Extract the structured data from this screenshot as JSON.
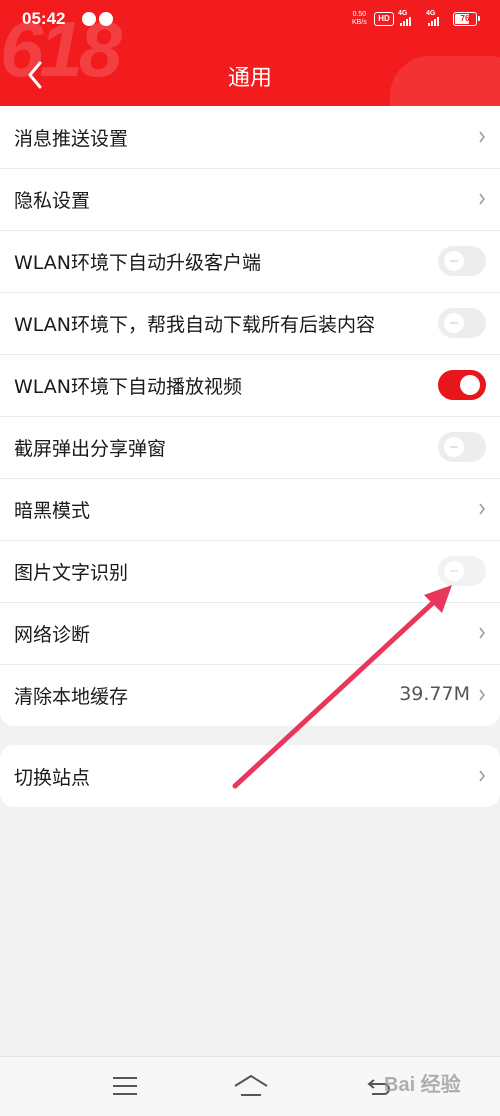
{
  "status_bar": {
    "time": "05:42",
    "net_speed_value": "0.50",
    "net_speed_unit": "KB/s",
    "hd_badge": "HD",
    "sim1_label": "4G",
    "sim2_label": "4G",
    "battery_percent": "76",
    "battery_level": 0.76
  },
  "header": {
    "title": "通用",
    "decoration_text": "618",
    "background_color": "#f21b1e"
  },
  "settings": {
    "items": [
      {
        "label": "消息推送设置",
        "control": "chevron"
      },
      {
        "label": "隐私设置",
        "control": "chevron"
      },
      {
        "label": "WLAN环境下自动升级客户端",
        "control": "toggle",
        "on": false
      },
      {
        "label": "WLAN环境下，帮我自动下载所有后装内容",
        "control": "toggle",
        "on": false
      },
      {
        "label": "WLAN环境下自动播放视频",
        "control": "toggle",
        "on": true
      },
      {
        "label": "截屏弹出分享弹窗",
        "control": "toggle",
        "on": false
      },
      {
        "label": "暗黑模式",
        "control": "chevron"
      },
      {
        "label": "图片文字识别",
        "control": "toggle",
        "on": false
      },
      {
        "label": "网络诊断",
        "control": "chevron"
      },
      {
        "label": "清除本地缓存",
        "control": "chevron",
        "value": "39.77M"
      }
    ],
    "switch_site": {
      "label": "切换站点",
      "control": "chevron"
    }
  },
  "colors": {
    "accent": "#e8151b",
    "annotation_arrow": "#e8375a",
    "toggle_off": "#ededed"
  },
  "nav_bar": {
    "watermark": "Bai 经验"
  }
}
